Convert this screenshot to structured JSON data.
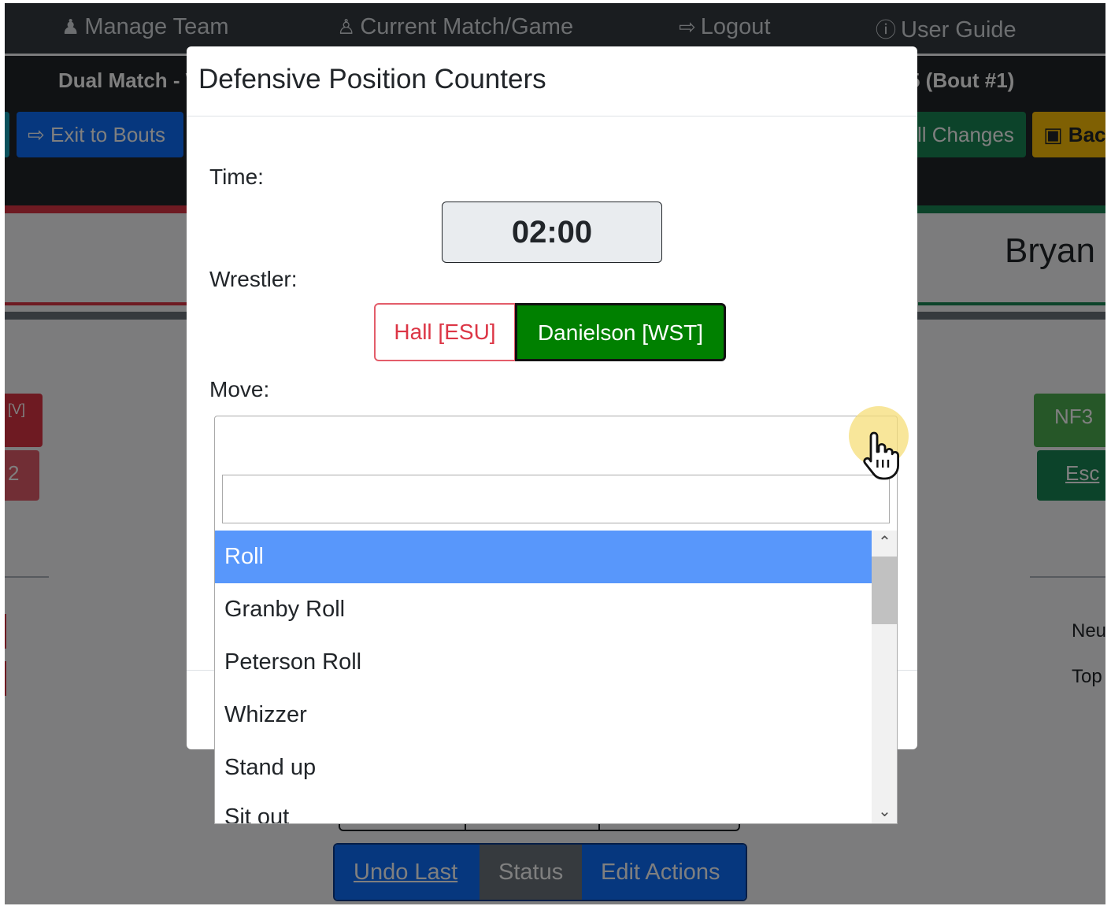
{
  "nav": {
    "items": [
      {
        "label": "Manage Team",
        "icon": "users-icon"
      },
      {
        "label": "Current Match/Game",
        "icon": "chess-icon"
      },
      {
        "label": "Logout",
        "icon": "logout-icon"
      },
      {
        "label": "User Guide",
        "icon": "info-circle-icon"
      }
    ]
  },
  "matchbar": {
    "left_text": "Dual Match - W",
    "right_text": "5 (Bout #1)"
  },
  "toolbar": {
    "exit_label": "Exit to Bouts",
    "changes_label": "ll Changes",
    "back_label": "Bac"
  },
  "background": {
    "wrestler_name": "Bryan",
    "red_chip_1": "[V]",
    "red_chip_2": "2",
    "green_chip_1": "NF3",
    "green_chip_2": "Esc",
    "label_neutral": "Neu",
    "label_top": "Top",
    "actions": {
      "undo_label": "Undo Last",
      "status_label": "Status",
      "edit_label": "Edit Actions"
    }
  },
  "modal": {
    "title": "Defensive Position Counters",
    "time_label": "Time:",
    "time_value": "02:00",
    "wrestler_label": "Wrestler:",
    "wrestlers": [
      {
        "label": "Hall [ESU]",
        "active": false
      },
      {
        "label": "Danielson [WST]",
        "active": true
      }
    ],
    "move_label": "Move:",
    "move_select": {
      "selected": "",
      "search_value": "",
      "options": [
        "Roll",
        "Granby Roll",
        "Peterson Roll",
        "Whizzer",
        "Stand up",
        "Sit out"
      ],
      "highlighted": "Roll"
    }
  },
  "colors": {
    "primary": "#0d6efd",
    "danger": "#dc3545",
    "success": "#198754",
    "active_wrestler": "#008000",
    "highlight_option": "#5897fb"
  }
}
